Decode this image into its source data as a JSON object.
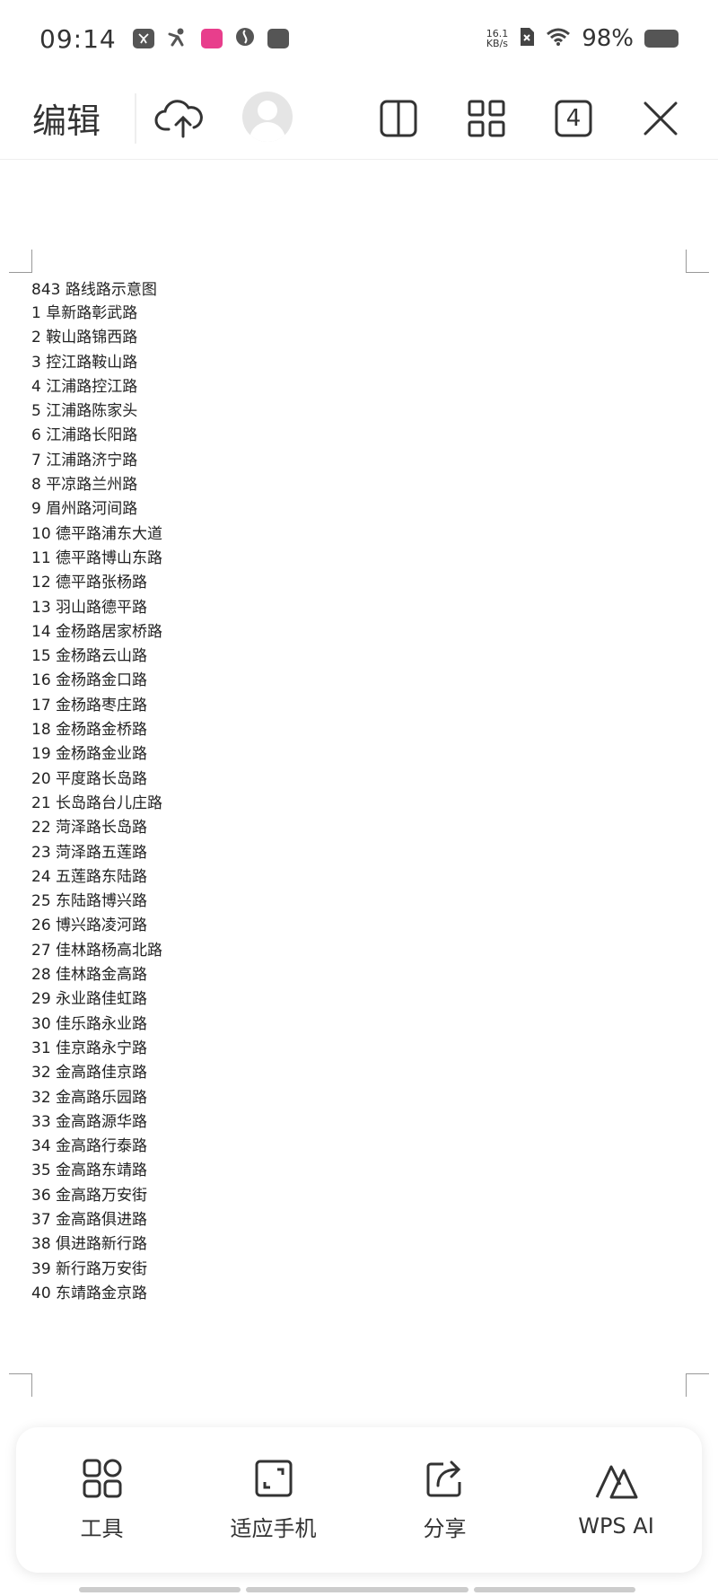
{
  "status_bar": {
    "time": "09:14",
    "net_speed_value": "16.1",
    "net_speed_unit": "KB/s",
    "battery": "98%",
    "app_icons": [
      "toutiao-icon",
      "person-icon",
      "pink-app-icon",
      "globe-icon",
      "news-icon"
    ]
  },
  "toolbar": {
    "edit_label": "编辑",
    "page_count": "4"
  },
  "document": {
    "title": "843 路线路示意图",
    "routes": [
      "1 阜新路彰武路",
      "2 鞍山路锦西路",
      "3 控江路鞍山路",
      "4 江浦路控江路",
      "5 江浦路陈家头",
      "6 江浦路长阳路",
      "7 江浦路济宁路",
      "8 平凉路兰州路",
      "9 眉州路河间路",
      "10 德平路浦东大道",
      "11 德平路博山东路",
      "12 德平路张杨路",
      "13 羽山路德平路",
      "14 金杨路居家桥路",
      "15 金杨路云山路",
      "16 金杨路金口路",
      "17 金杨路枣庄路",
      "18 金杨路金桥路",
      "19 金杨路金业路",
      "20 平度路长岛路",
      "21 长岛路台儿庄路",
      "22 菏泽路长岛路",
      "23 菏泽路五莲路",
      "24 五莲路东陆路",
      "25 东陆路博兴路",
      "26 博兴路凌河路",
      "27 佳林路杨高北路",
      "28 佳林路金高路",
      "29 永业路佳虹路",
      "30 佳乐路永业路",
      "31 佳京路永宁路",
      "32 金高路佳京路",
      "32 金高路乐园路",
      "33 金高路源华路",
      "34 金高路行泰路",
      "35 金高路东靖路",
      "36 金高路万安街",
      "37 金高路俱进路",
      "38 俱进路新行路",
      "39 新行路万安街",
      "40 东靖路金京路"
    ]
  },
  "bottom_bar": {
    "tools_label": "工具",
    "fit_label": "适应手机",
    "share_label": "分享",
    "ai_label": "WPS AI"
  }
}
